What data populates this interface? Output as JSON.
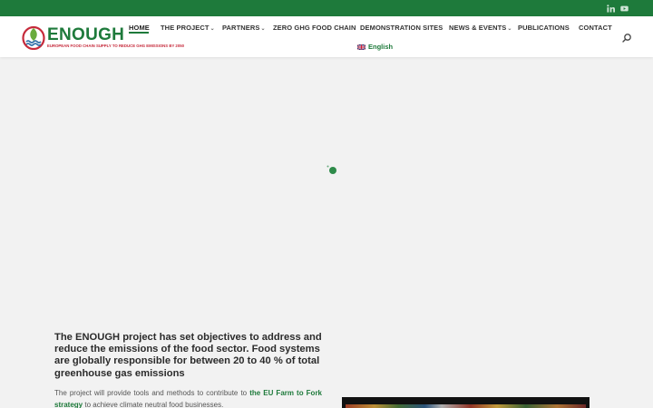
{
  "brand": {
    "name": "ENOUGH",
    "tagline": "EUROPEAN FOOD CHAIN SUPPLY TO REDUCE GHG EMISSIONS BY 2050",
    "colors": {
      "primary": "#1e7a3b",
      "accent": "#c62a3b",
      "topbar": "#1e7a3b"
    }
  },
  "topbar": {
    "social": [
      {
        "icon": "linkedin-icon",
        "label": "LinkedIn"
      },
      {
        "icon": "youtube-icon",
        "label": "YouTube"
      }
    ]
  },
  "nav": {
    "items": [
      {
        "label": "HOME",
        "active": true,
        "has_submenu": false
      },
      {
        "label": "THE PROJECT",
        "active": false,
        "has_submenu": true
      },
      {
        "label": "PARTNERS",
        "active": false,
        "has_submenu": true
      },
      {
        "label": "ZERO GHG FOOD CHAIN",
        "active": false,
        "has_submenu": false
      },
      {
        "label": "DEMONSTRATION SITES",
        "active": false,
        "has_submenu": false
      },
      {
        "label": "NEWS & EVENTS",
        "active": false,
        "has_submenu": true
      },
      {
        "label": "PUBLICATIONS",
        "active": false,
        "has_submenu": false
      },
      {
        "label": "CONTACT",
        "active": false,
        "has_submenu": false
      }
    ],
    "language": "English",
    "language_flag": "uk-flag-icon",
    "search_icon": "search-icon"
  },
  "main": {
    "headline": "The ENOUGH project has set objectives to address and reduce the emissions of the food sector. Food systems are globally responsible for between 20 to 40 % of total greenhouse gas emissions",
    "para_before": "The project will provide tools and methods to contribute to ",
    "para_link": "the EU Farm to Fork strategy",
    "para_after": " to achieve climate neutral food businesses."
  }
}
